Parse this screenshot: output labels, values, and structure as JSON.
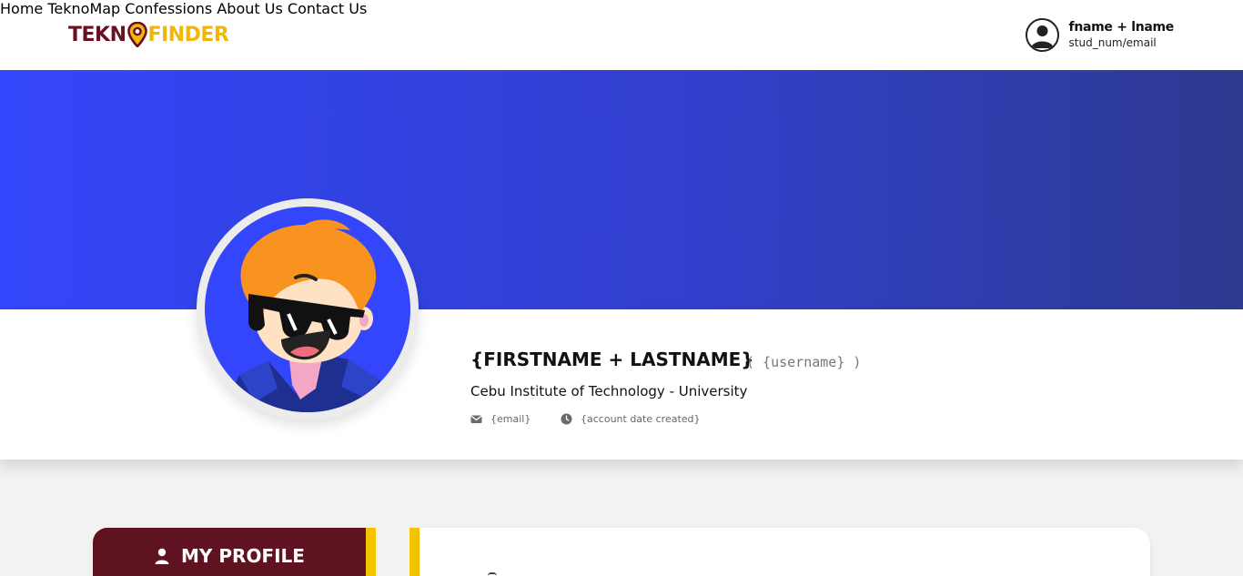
{
  "brand": {
    "part1": "TEKN",
    "part2": "FINDER",
    "colors": {
      "primary": "#6b1020",
      "accent": "#f2b705",
      "pin_fill": "#f2b705"
    }
  },
  "nav": {
    "items": [
      "Home",
      "TeknoMap",
      "Confessions",
      "About Us",
      "Contact Us"
    ]
  },
  "user": {
    "name": "fname + lname",
    "sub": "stud_num/email"
  },
  "banner": {
    "gradient": [
      "#3446fb",
      "#3140cd",
      "#2d3a90"
    ]
  },
  "profile": {
    "fullname": "{FIRSTNAME + LASTNAME}",
    "username": "( {username} )",
    "school": "Cebu Institute of Technology - University",
    "email": "{email}",
    "created": "{account date created}"
  },
  "sidebar": {
    "title": "MY PROFILE",
    "bg": "#5f1220",
    "stripe": "#f5c400"
  },
  "icons": {
    "email": "envelope-icon",
    "date": "clock-icon",
    "avatar": "user-circle-icon",
    "profile": "person-icon"
  }
}
